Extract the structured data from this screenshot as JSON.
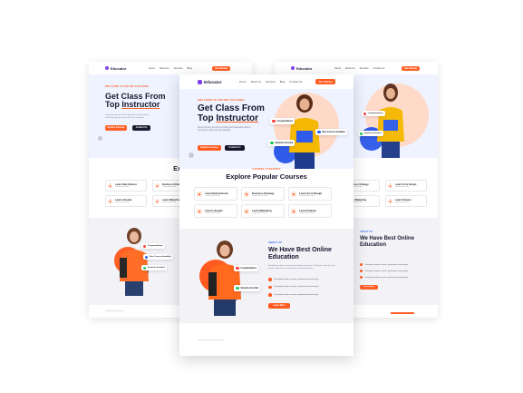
{
  "brand": {
    "name": "Educator"
  },
  "nav": {
    "links": [
      "Home",
      "About Us",
      "Services",
      "Blog",
      "Contact Us"
    ],
    "cta": "Get Started"
  },
  "hero": {
    "tag": "WELCOME TO ONLINE COACHING",
    "title_line1": "Get Class From",
    "title_line2_plain": "Top ",
    "title_line2_highlight": "Instructor",
    "paragraph": "Simply dummy text of the printing and typesetting industry lorem ipsum has been the standard.",
    "primary_button": "Explore Courses",
    "secondary_button": "Contact Us",
    "badge_1": "Congratulations",
    "badge_2": "New Courses Available",
    "badge_3": "Students Enrolled"
  },
  "courses": {
    "tag": "COURSE CATEGORY",
    "title": "Explore Popular Courses",
    "items": [
      {
        "name": "Learn Data Science",
        "sub": "Lorem Ipsum Dolor"
      },
      {
        "name": "Business Strategy",
        "sub": "Lorem Ipsum Dolor"
      },
      {
        "name": "Learn Art & Design",
        "sub": "Lorem Ipsum Dolor"
      },
      {
        "name": "Learn Lifestyle",
        "sub": "Lorem Ipsum Dolor"
      },
      {
        "name": "Learn Marketing",
        "sub": "Lorem Ipsum Dolor"
      },
      {
        "name": "Learn Finance",
        "sub": "Lorem Ipsum Dolor"
      }
    ]
  },
  "about": {
    "tag": "ABOUT US",
    "title_line1": "We Have Best Online",
    "title_line2": "Education",
    "paragraph": "Readable content of a page when looking at its layout. The point of using Lorem Ipsum is that it has a more-or-less normal distribution.",
    "bullets": [
      "Exceptional online courses, professional mentorships",
      "Exceptional online courses, professional mentorships",
      "Exceptional online courses, professional mentorships"
    ],
    "button": "Learn More"
  },
  "colors": {
    "accent": "#ff5a1f",
    "dark": "#14142b",
    "purple": "#7b3fe4",
    "blue": "#2563eb",
    "hero_bg": "#eef3ff"
  }
}
